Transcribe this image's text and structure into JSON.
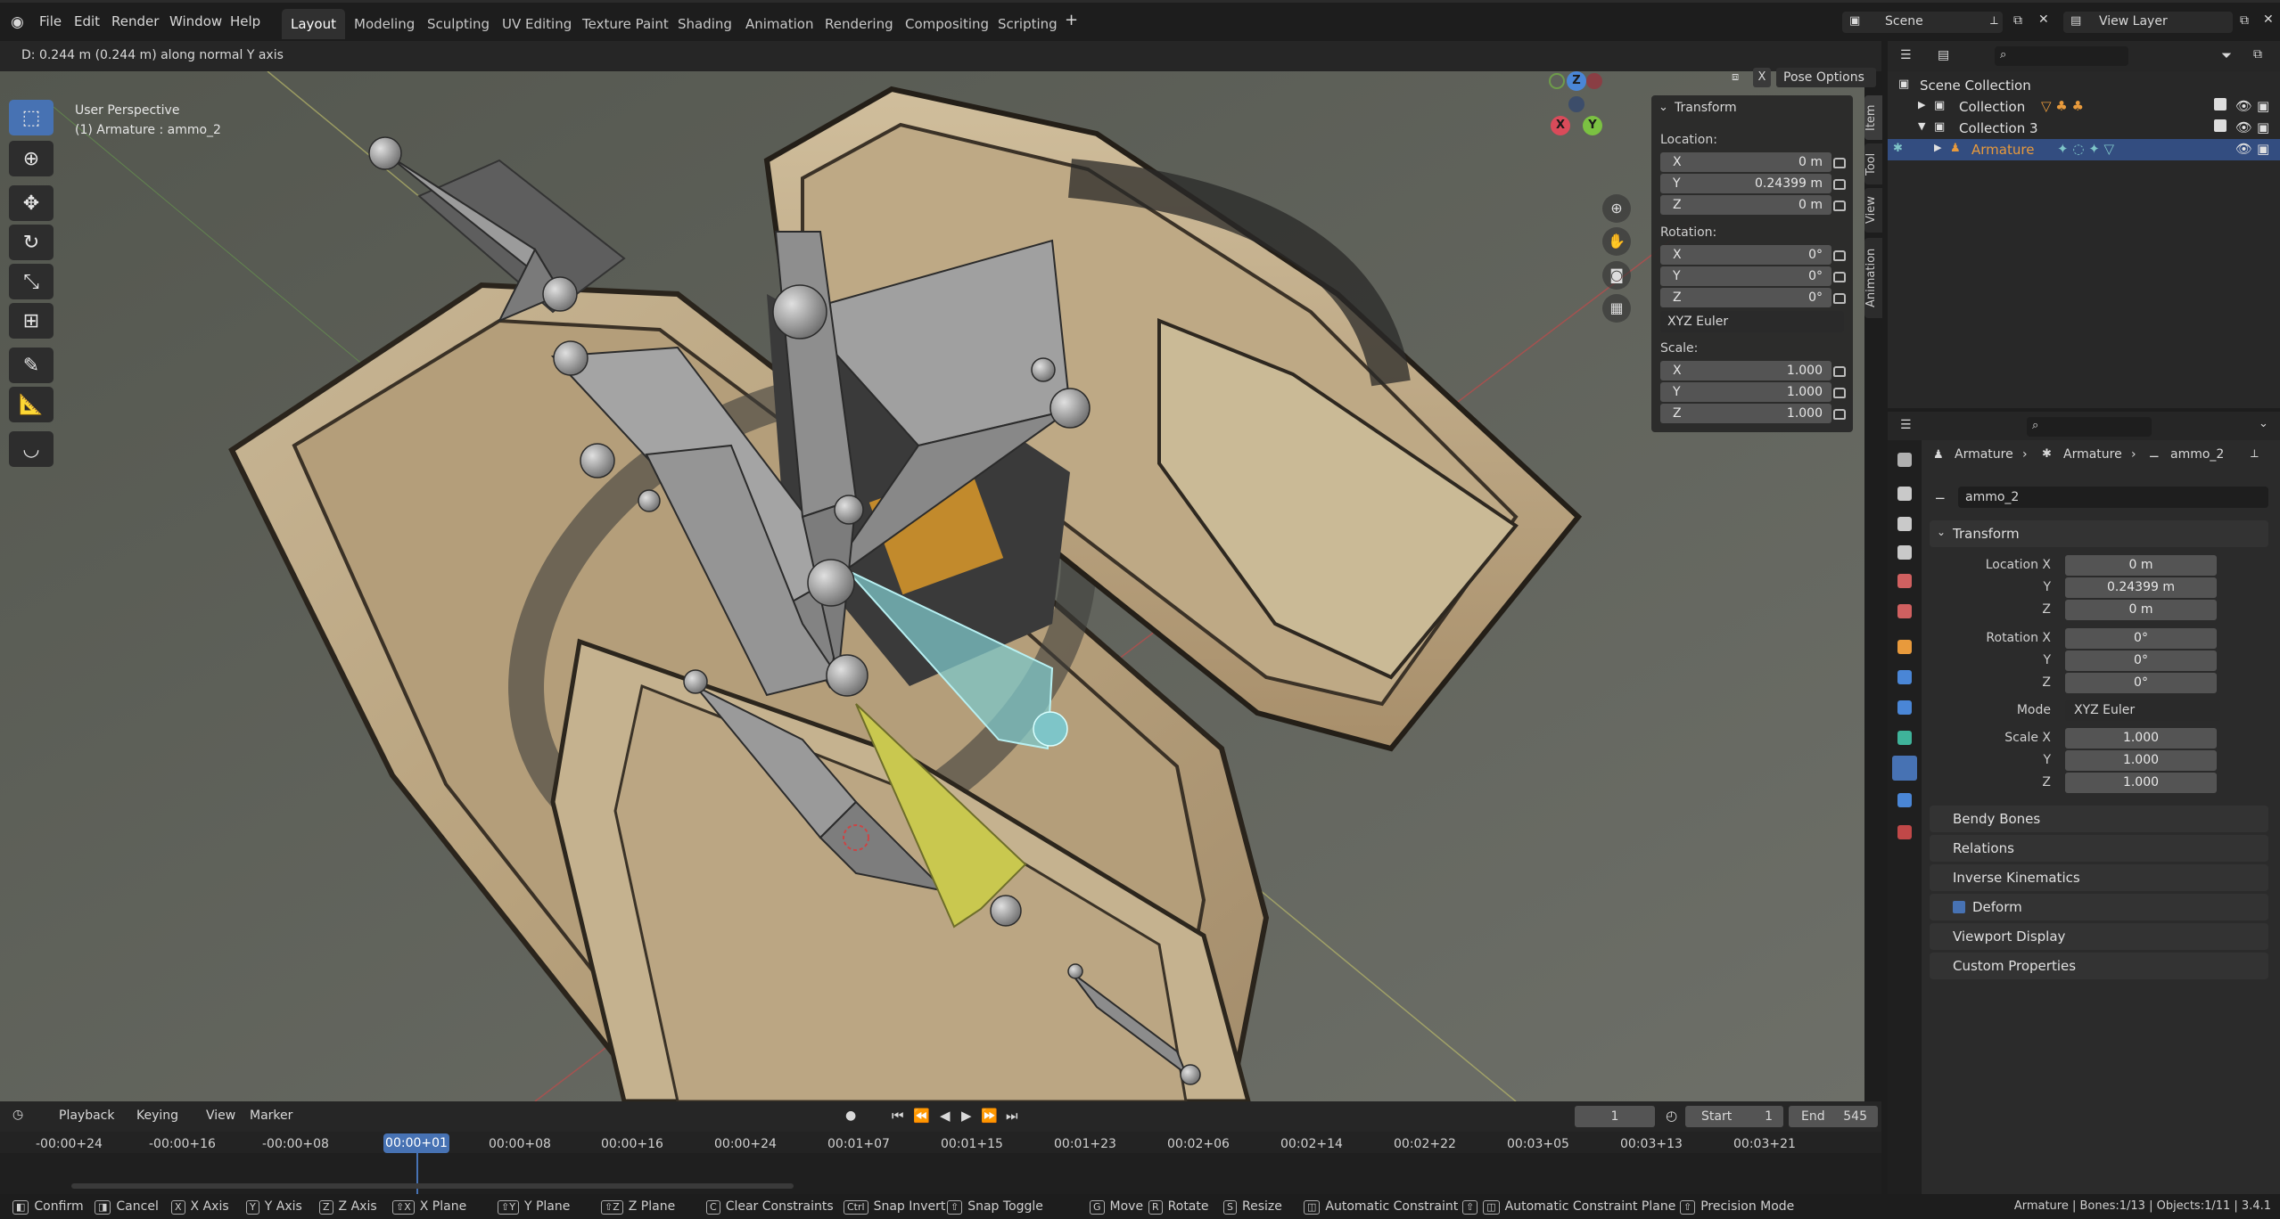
{
  "menus": {
    "file": "File",
    "edit": "Edit",
    "render": "Render",
    "window": "Window",
    "help": "Help"
  },
  "workspaces": [
    "Layout",
    "Modeling",
    "Sculpting",
    "UV Editing",
    "Texture Paint",
    "Shading",
    "Animation",
    "Rendering",
    "Compositing",
    "Scripting"
  ],
  "active_workspace": "Layout",
  "scene": {
    "name": "Scene",
    "view_layer": "View Layer"
  },
  "status_header": "D: 0.244 m (0.244 m) along normal Y axis",
  "viewport": {
    "perspective": "User Perspective",
    "object": "(1) Armature : ammo_2",
    "pose_options": "Pose Options",
    "x_btn": "X",
    "gizmo": {
      "x": "X",
      "y": "Y",
      "z": "Z"
    }
  },
  "npanel": {
    "title": "Transform",
    "location_label": "Location:",
    "rotation_label": "Rotation:",
    "scale_label": "Scale:",
    "location": [
      {
        "k": "X",
        "v": "0 m"
      },
      {
        "k": "Y",
        "v": "0.24399 m"
      },
      {
        "k": "Z",
        "v": "0 m"
      }
    ],
    "rotation": [
      {
        "k": "X",
        "v": "0°"
      },
      {
        "k": "Y",
        "v": "0°"
      },
      {
        "k": "Z",
        "v": "0°"
      }
    ],
    "rotation_mode": "XYZ Euler",
    "scale": [
      {
        "k": "X",
        "v": "1.000"
      },
      {
        "k": "Y",
        "v": "1.000"
      },
      {
        "k": "Z",
        "v": "1.000"
      }
    ],
    "tabs": [
      "Item",
      "Tool",
      "View",
      "Animation"
    ]
  },
  "outliner": {
    "rows": [
      {
        "label": "Scene Collection"
      },
      {
        "label": "Collection"
      },
      {
        "label": "Collection 3"
      },
      {
        "label": "Armature"
      }
    ]
  },
  "properties": {
    "breadcrumb": [
      "Armature",
      "Armature",
      "ammo_2"
    ],
    "bone_name": "ammo_2",
    "transform_title": "Transform",
    "loc_labels": [
      "Location X",
      "Y",
      "Z"
    ],
    "loc_values": [
      "0 m",
      "0.24399 m",
      "0 m"
    ],
    "rot_labels": [
      "Rotation X",
      "Y",
      "Z"
    ],
    "rot_values": [
      "0°",
      "0°",
      "0°"
    ],
    "mode_label": "Mode",
    "mode_value": "XYZ Euler",
    "scale_labels": [
      "Scale X",
      "Y",
      "Z"
    ],
    "scale_values": [
      "1.000",
      "1.000",
      "1.000"
    ],
    "panels": [
      "Bendy Bones",
      "Relations",
      "Inverse Kinematics",
      "Deform",
      "Viewport Display",
      "Custom Properties"
    ]
  },
  "timeline": {
    "menus": [
      "Playback",
      "Keying",
      "View",
      "Marker"
    ],
    "current_frame": "1",
    "start_label": "Start",
    "start": "1",
    "end_label": "End",
    "end": "545",
    "labels": [
      "-00:00+24",
      "-00:00+16",
      "-00:00+08",
      "00:00+01",
      "00:00+08",
      "00:00+16",
      "00:00+24",
      "00:01+07",
      "00:01+15",
      "00:01+23",
      "00:02+06",
      "00:02+14",
      "00:02+22",
      "00:03+05",
      "00:03+13",
      "00:03+21"
    ]
  },
  "statusbar": {
    "items": [
      {
        "key": "",
        "label": "Confirm"
      },
      {
        "key": "",
        "label": "Cancel"
      },
      {
        "key": "X",
        "label": "X Axis"
      },
      {
        "key": "Y",
        "label": "Y Axis"
      },
      {
        "key": "Z",
        "label": "Z Axis"
      },
      {
        "key": "⇧X",
        "label": "X Plane"
      },
      {
        "key": "⇧Y",
        "label": "Y Plane"
      },
      {
        "key": "⇧Z",
        "label": "Z Plane"
      },
      {
        "key": "C",
        "label": "Clear Constraints"
      },
      {
        "key": "Ctrl",
        "label": "Snap Invert"
      },
      {
        "key": "⇧",
        "label": "Snap Toggle"
      },
      {
        "key": "G",
        "label": "Move"
      },
      {
        "key": "R",
        "label": "Rotate"
      },
      {
        "key": "S",
        "label": "Resize"
      },
      {
        "key": "",
        "label": "Automatic Constraint"
      },
      {
        "key": "⇧",
        "label": "Automatic Constraint Plane"
      },
      {
        "key": "⇧",
        "label": "Precision Mode"
      }
    ],
    "stats": "Armature | Bones:1/13 | Objects:1/11 | 3.4.1"
  },
  "colors": {
    "accent": "#4772b3",
    "selected_bone": "#c9c84f",
    "active_bone": "#7ec5c8",
    "armature_orange": "#e89a3c"
  }
}
